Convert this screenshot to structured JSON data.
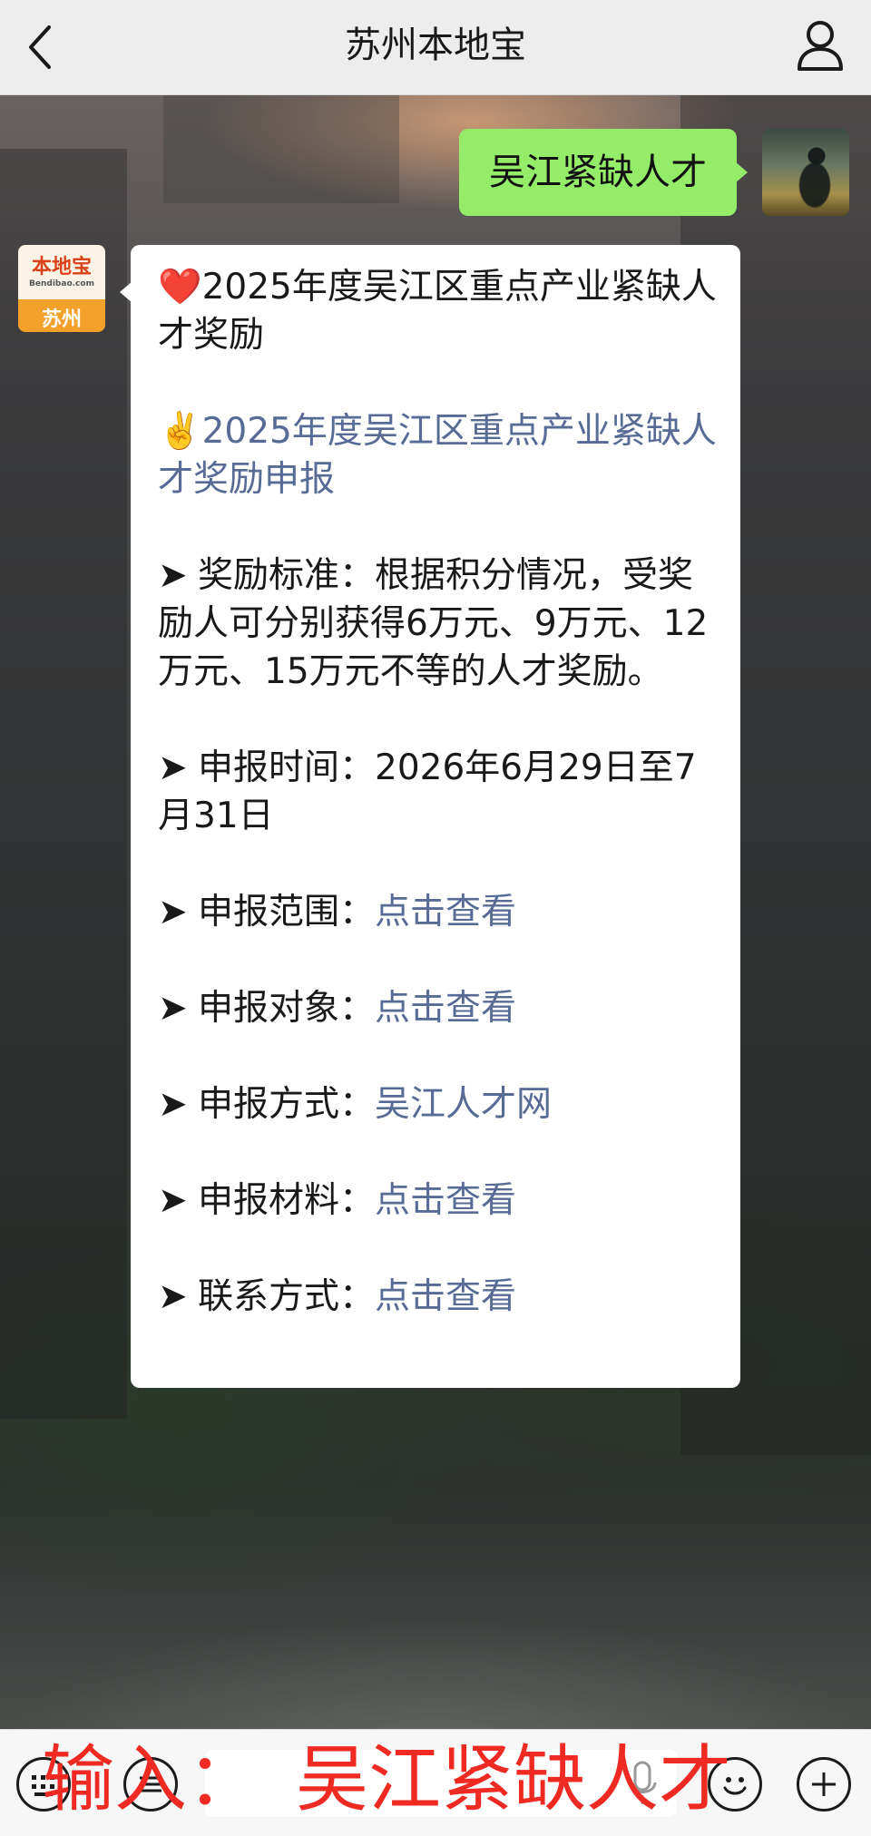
{
  "header": {
    "title": "苏州本地宝",
    "back_icon": "chevron-left-icon",
    "profile_icon": "person-icon"
  },
  "bot": {
    "logo_text": "本地宝",
    "logo_url": "Bendibao.com",
    "city": "苏州"
  },
  "user_message": "吴江紧缺人才",
  "reply": {
    "heading_emoji": "❤️",
    "heading": "2025年度吴江区重点产业紧缺人才奖励",
    "link_emoji": "✌️",
    "link": "2025年度吴江区重点产业紧缺人才奖励申报",
    "arrow": "➤",
    "items": [
      {
        "label": "奖励标准：",
        "text": "根据积分情况，受奖励人可分别获得6万元、9万元、12万元、15万元不等的人才奖励。"
      },
      {
        "label": "申报时间：",
        "text": "2026年6月29日至7月31日"
      },
      {
        "label": "申报范围：",
        "link": "点击查看"
      },
      {
        "label": "申报对象：",
        "link": "点击查看"
      },
      {
        "label": "申报方式：",
        "link": "吴江人才网"
      },
      {
        "label": "申报材料：",
        "link": "点击查看"
      },
      {
        "label": "联系方式：",
        "link": "点击查看"
      }
    ]
  },
  "annotation": {
    "lead": "输入：",
    "text": "吴江紧缺人才"
  },
  "colors": {
    "header_bg": "#ededed",
    "out_bubble": "#95ec69",
    "link": "#576b95",
    "annotation": "#ee2a22"
  }
}
